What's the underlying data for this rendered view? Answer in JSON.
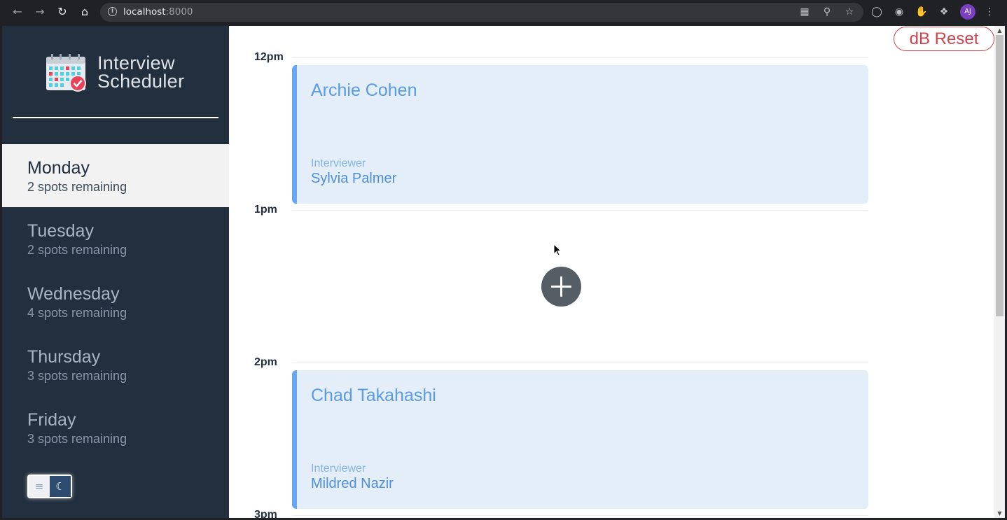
{
  "browser": {
    "url_host": "localhost",
    "url_port": ":8000",
    "avatar_initials": "AJ"
  },
  "sidebar": {
    "logo_line1": "Interview",
    "logo_line2": "Scheduler",
    "days": [
      {
        "name": "Monday",
        "spots": "2 spots remaining",
        "selected": true
      },
      {
        "name": "Tuesday",
        "spots": "2 spots remaining",
        "selected": false
      },
      {
        "name": "Wednesday",
        "spots": "4 spots remaining",
        "selected": false
      },
      {
        "name": "Thursday",
        "spots": "3 spots remaining",
        "selected": false
      },
      {
        "name": "Friday",
        "spots": "3 spots remaining",
        "selected": false
      }
    ]
  },
  "schedule": {
    "hours": [
      "12pm",
      "1pm",
      "2pm",
      "3pm"
    ],
    "appointments": [
      {
        "student": "Archie Cohen",
        "interviewer_label": "Interviewer",
        "interviewer": "Sylvia Palmer"
      },
      {
        "student": "Chad Takahashi",
        "interviewer_label": "Interviewer",
        "interviewer": "Mildred Nazir"
      }
    ],
    "reset_label": "dB Reset"
  },
  "colors": {
    "sidebar_bg": "#222f3e",
    "appointment_bg": "#e4eef9",
    "appointment_accent": "#66a6f5",
    "reset_accent": "#c9464e",
    "add_button": "#555d65"
  }
}
